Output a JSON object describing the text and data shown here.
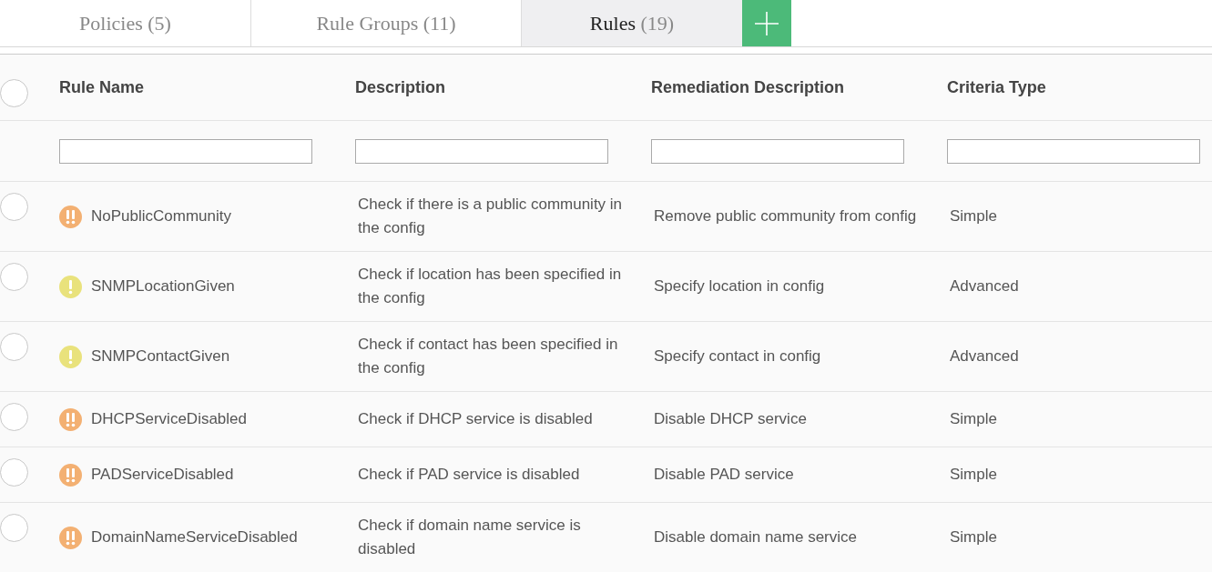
{
  "tabs": [
    {
      "label": "Policies",
      "count": "(5)",
      "selected": false
    },
    {
      "label": "Rule Groups",
      "count": "(11)",
      "selected": false
    },
    {
      "label": "Rules",
      "count": "(19)",
      "selected": true
    }
  ],
  "table": {
    "select_all": {
      "checked": false
    },
    "columns": [
      "Rule Name",
      "Description",
      "Remediation Description",
      "Criteria Type"
    ],
    "rows": [
      {
        "checked": false,
        "kind": "high",
        "name": "NoPublicCommunity",
        "description": "Check if there is a public community in the config",
        "remediation": "Remove public community from config",
        "criteria_type": "Simple"
      },
      {
        "checked": false,
        "kind": "medium",
        "name": "SNMPLocationGiven",
        "description": "Check if location has been specified in the config",
        "remediation": "Specify location in config",
        "criteria_type": "Advanced"
      },
      {
        "checked": false,
        "kind": "medium",
        "name": "SNMPContactGiven",
        "description": "Check if contact has been specified in the config",
        "remediation": "Specify contact in config",
        "criteria_type": "Advanced"
      },
      {
        "checked": false,
        "kind": "high",
        "name": "DHCPServiceDisabled",
        "description": "Check if DHCP service is disabled",
        "remediation": "Disable DHCP service",
        "criteria_type": "Simple"
      },
      {
        "checked": false,
        "kind": "high",
        "name": "PADServiceDisabled",
        "description": "Check if PAD service is disabled",
        "remediation": "Disable PAD service",
        "criteria_type": "Simple"
      },
      {
        "checked": false,
        "kind": "high",
        "name": "DomainNameServiceDisabled",
        "description": "Check if domain name service is disabled",
        "remediation": "Disable domain name service",
        "criteria_type": "Simple"
      }
    ]
  }
}
